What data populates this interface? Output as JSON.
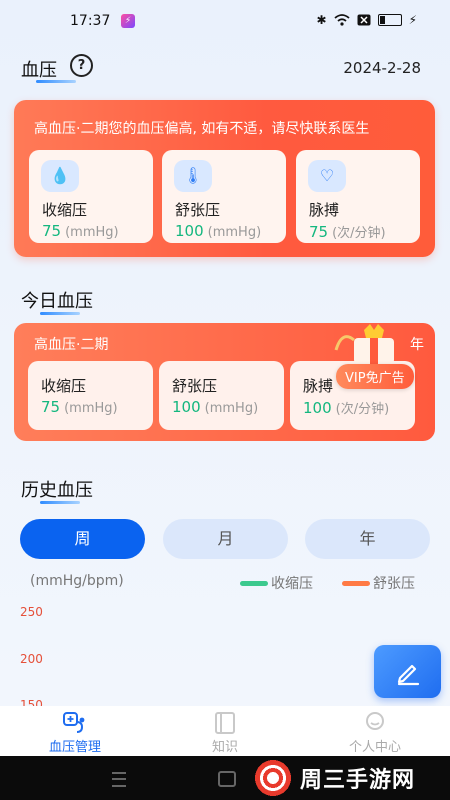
{
  "status_bar": {
    "time": "17:37",
    "app_icon_glyph": "⚡"
  },
  "header": {
    "title": "血压",
    "help_glyph": "?",
    "date": "2024-2-28"
  },
  "alert": {
    "text": "高血压·二期您的血压偏高, 如有不适，请尽快联系医生",
    "metrics": [
      {
        "label": "收缩压",
        "value": "75",
        "unit": "(mmHg)",
        "icon": "blood-drop-icon"
      },
      {
        "label": "舒张压",
        "value": "100",
        "unit": "(mmHg)",
        "icon": "thermometer-icon"
      },
      {
        "label": "脉搏",
        "value": "75",
        "unit": "(次/分钟)",
        "icon": "heart-pulse-icon"
      }
    ]
  },
  "today": {
    "title": "今日血压",
    "stage": "高血压·二期",
    "year_fragment": "年",
    "vip_badge": "VIP免广告",
    "metrics": [
      {
        "label": "收缩压",
        "value": "75",
        "unit": "(mmHg)"
      },
      {
        "label": "舒张压",
        "value": "100",
        "unit": "(mmHg)"
      },
      {
        "label": "脉搏",
        "value": "100",
        "unit": "(次/分钟)"
      }
    ]
  },
  "history": {
    "title": "历史血压",
    "tabs": [
      {
        "label": "周",
        "active": true
      },
      {
        "label": "月",
        "active": false
      },
      {
        "label": "年",
        "active": false
      }
    ],
    "unit_label": "(mmHg/bpm)",
    "legend": [
      {
        "label": "收缩压",
        "color": "#3cc98e"
      },
      {
        "label": "舒张压",
        "color": "#ff7a45"
      }
    ]
  },
  "chart_data": {
    "type": "line",
    "ylabel": "(mmHg/bpm)",
    "yticks": [
      "250",
      "200",
      "150"
    ],
    "series": [
      {
        "name": "收缩压",
        "values": []
      },
      {
        "name": "舒张压",
        "values": []
      }
    ],
    "grid": false,
    "legend_position": "top-right"
  },
  "fab": {
    "icon": "edit-pencil-icon"
  },
  "bottom_nav": [
    {
      "label": "血压管理",
      "icon": "stethoscope-icon",
      "active": true
    },
    {
      "label": "知识",
      "icon": "book-icon",
      "active": false
    },
    {
      "label": "个人中心",
      "icon": "user-icon",
      "active": false
    }
  ],
  "watermark": {
    "text": "周三手游网"
  }
}
